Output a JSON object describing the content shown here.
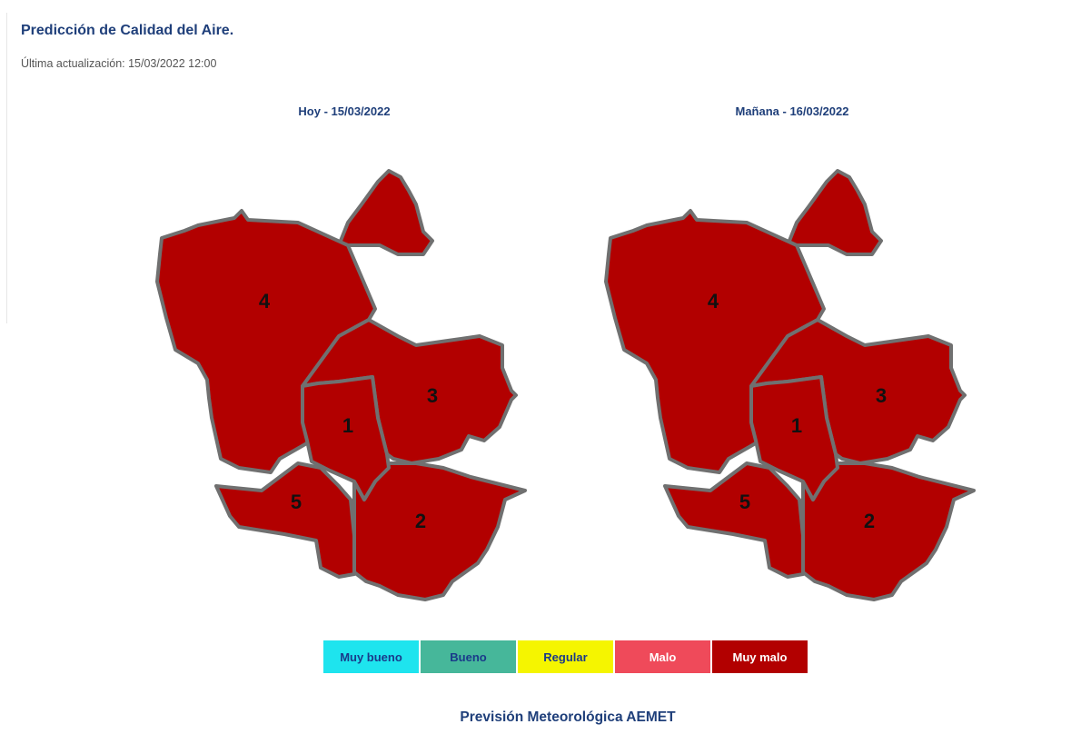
{
  "header": {
    "title": "Predicción de Calidad del Aire.",
    "updated": "Última actualización: 15/03/2022 12:00"
  },
  "maps": [
    {
      "title": "Hoy - 15/03/2022",
      "zones": [
        {
          "label": "1",
          "level": "Muy malo"
        },
        {
          "label": "2",
          "level": "Muy malo"
        },
        {
          "label": "3",
          "level": "Muy malo"
        },
        {
          "label": "4",
          "level": "Muy malo"
        },
        {
          "label": "5",
          "level": "Muy malo"
        }
      ]
    },
    {
      "title": "Mañana - 16/03/2022",
      "zones": [
        {
          "label": "1",
          "level": "Muy malo"
        },
        {
          "label": "2",
          "level": "Muy malo"
        },
        {
          "label": "3",
          "level": "Muy malo"
        },
        {
          "label": "4",
          "level": "Muy malo"
        },
        {
          "label": "5",
          "level": "Muy malo"
        }
      ]
    }
  ],
  "legend": [
    {
      "label": "Muy bueno",
      "color": "#1ee4ee",
      "text_color": "#1a3a8a"
    },
    {
      "label": "Bueno",
      "color": "#46b79a",
      "text_color": "#1a3a8a"
    },
    {
      "label": "Regular",
      "color": "#f5f500",
      "text_color": "#1a3a8a"
    },
    {
      "label": "Malo",
      "color": "#ef4a5a",
      "text_color": "#ffffff"
    },
    {
      "label": "Muy malo",
      "color": "#b20000",
      "text_color": "#ffffff"
    }
  ],
  "footer": "Previsión Meteorológica AEMET"
}
